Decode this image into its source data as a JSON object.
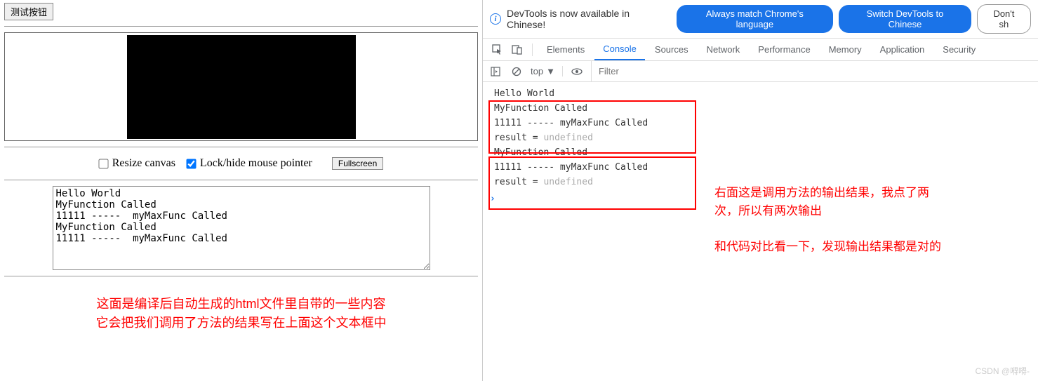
{
  "left": {
    "test_button": "测试按钮",
    "controls": {
      "resize_label": "Resize canvas",
      "lock_label": "Lock/hide mouse pointer",
      "fullscreen": "Fullscreen",
      "resize_checked": false,
      "lock_checked": true
    },
    "textarea_content": "Hello World\nMyFunction Called\n11111 -----  myMaxFunc Called\nMyFunction Called\n11111 -----  myMaxFunc Called",
    "annotation_line1": "这面是编译后自动生成的html文件里自带的一些内容",
    "annotation_line2": "它会把我们调用了方法的结果写在上面这个文本框中"
  },
  "devtools": {
    "info_bar": {
      "message": "DevTools is now available in Chinese!",
      "always_match": "Always match Chrome's language",
      "switch_to": "Switch DevTools to Chinese",
      "dont_show": "Don't sh"
    },
    "tabs": [
      "Elements",
      "Console",
      "Sources",
      "Network",
      "Performance",
      "Memory",
      "Application",
      "Security"
    ],
    "active_tab": "Console",
    "toolbar": {
      "context": "top",
      "filter_placeholder": "Filter"
    },
    "console_logs": [
      {
        "type": "log",
        "text": "Hello World"
      },
      {
        "type": "log",
        "text": "MyFunction Called"
      },
      {
        "type": "log",
        "text": "11111 -----  myMaxFunc Called"
      },
      {
        "type": "result",
        "prefix": "result = ",
        "value": "undefined"
      },
      {
        "type": "log",
        "text": "MyFunction Called"
      },
      {
        "type": "log",
        "text": "11111 -----  myMaxFunc Called"
      },
      {
        "type": "result",
        "prefix": "result = ",
        "value": "undefined"
      }
    ],
    "annotation_line1": "右面这是调用方法的输出结果，我点了两",
    "annotation_line2": "次，所以有两次输出",
    "annotation_line3": "和代码对比看一下，发现输出结果都是对的"
  },
  "watermark": "CSDN @嘚嘚-"
}
